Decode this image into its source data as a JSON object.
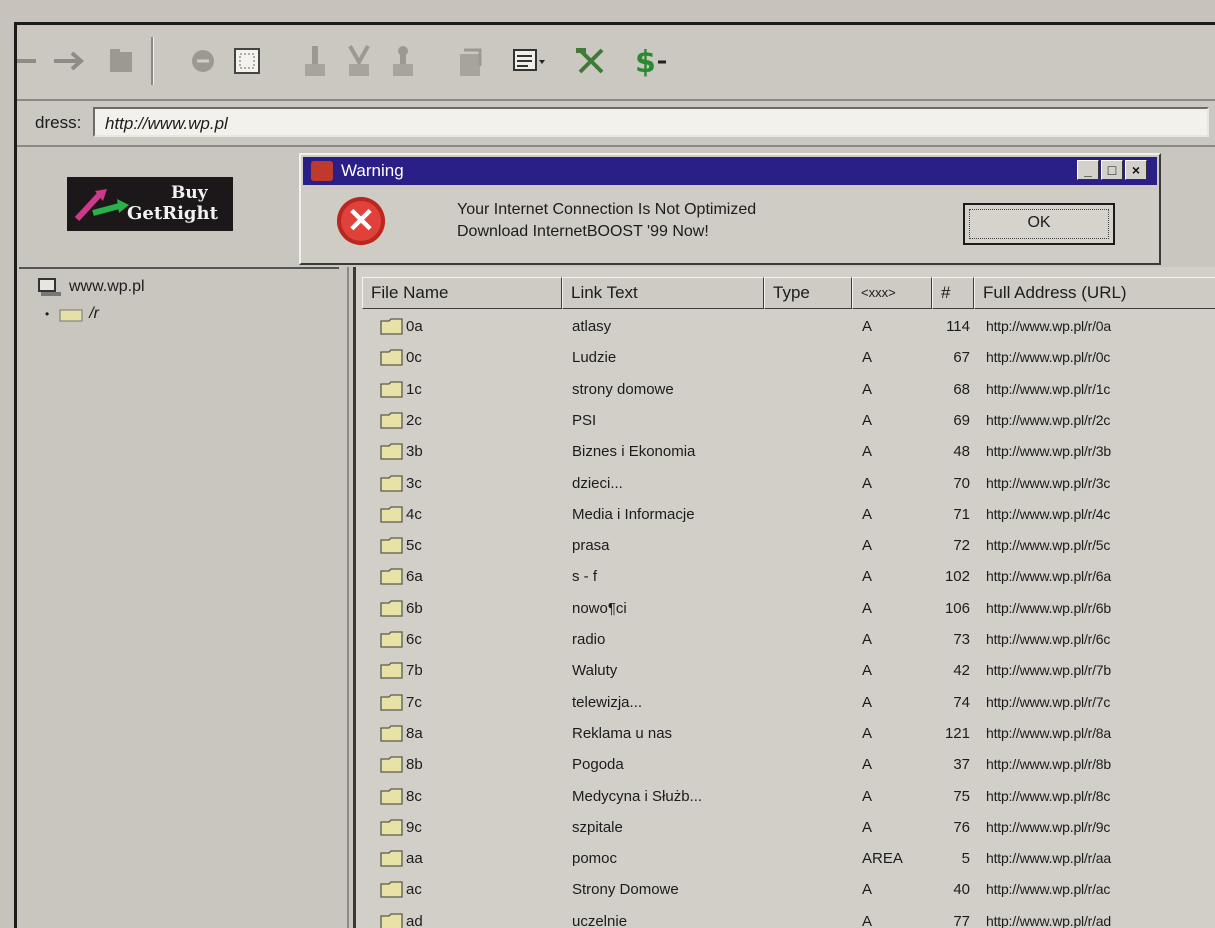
{
  "toolbar": {
    "buttons": [
      "back-icon",
      "forward-icon",
      "folder-icon",
      "stop-icon",
      "select-icon",
      "download-icon",
      "download-all-icon",
      "upload-icon",
      "properties-icon",
      "view-menu-icon",
      "tools-icon",
      "dollar-menu-icon"
    ]
  },
  "address": {
    "label": "dress:",
    "value": "http://www.wp.pl"
  },
  "banner": {
    "buy": "Buy",
    "name": "GetRight"
  },
  "warning": {
    "title": "Warning",
    "line1": "Your Internet Connection Is Not Optimized",
    "line2": "Download InternetBOOST '99 Now!",
    "ok": "OK",
    "min": "_",
    "max": "□",
    "close": "×"
  },
  "tree": {
    "root": "www.wp.pl",
    "child": "/r"
  },
  "columns": {
    "file": "File Name",
    "link": "Link Text",
    "type": "Type",
    "tag": "<xxx>",
    "num": "#",
    "url": "Full Address (URL)"
  },
  "rows": [
    {
      "file": "0a",
      "link": "atlasy",
      "tag": "A",
      "num": "114",
      "url": "http://www.wp.pl/r/0a"
    },
    {
      "file": "0c",
      "link": "Ludzie",
      "tag": "A",
      "num": "67",
      "url": "http://www.wp.pl/r/0c"
    },
    {
      "file": "1c",
      "link": "strony domowe",
      "tag": "A",
      "num": "68",
      "url": "http://www.wp.pl/r/1c"
    },
    {
      "file": "2c",
      "link": "PSI",
      "tag": "A",
      "num": "69",
      "url": "http://www.wp.pl/r/2c"
    },
    {
      "file": "3b",
      "link": "Biznes i Ekonomia",
      "tag": "A",
      "num": "48",
      "url": "http://www.wp.pl/r/3b"
    },
    {
      "file": "3c",
      "link": "dzieci...",
      "tag": "A",
      "num": "70",
      "url": "http://www.wp.pl/r/3c"
    },
    {
      "file": "4c",
      "link": "Media i Informacje",
      "tag": "A",
      "num": "71",
      "url": "http://www.wp.pl/r/4c"
    },
    {
      "file": "5c",
      "link": "prasa",
      "tag": "A",
      "num": "72",
      "url": "http://www.wp.pl/r/5c"
    },
    {
      "file": "6a",
      "link": "s - f",
      "tag": "A",
      "num": "102",
      "url": "http://www.wp.pl/r/6a"
    },
    {
      "file": "6b",
      "link": "nowo¶ci",
      "tag": "A",
      "num": "106",
      "url": "http://www.wp.pl/r/6b"
    },
    {
      "file": "6c",
      "link": "radio",
      "tag": "A",
      "num": "73",
      "url": "http://www.wp.pl/r/6c"
    },
    {
      "file": "7b",
      "link": "Waluty",
      "tag": "A",
      "num": "42",
      "url": "http://www.wp.pl/r/7b"
    },
    {
      "file": "7c",
      "link": "telewizja...",
      "tag": "A",
      "num": "74",
      "url": "http://www.wp.pl/r/7c"
    },
    {
      "file": "8a",
      "link": "Reklama u nas",
      "tag": "A",
      "num": "121",
      "url": "http://www.wp.pl/r/8a"
    },
    {
      "file": "8b",
      "link": "Pogoda",
      "tag": "A",
      "num": "37",
      "url": "http://www.wp.pl/r/8b"
    },
    {
      "file": "8c",
      "link": "Medycyna i Służb...",
      "tag": "A",
      "num": "75",
      "url": "http://www.wp.pl/r/8c"
    },
    {
      "file": "9c",
      "link": "szpitale",
      "tag": "A",
      "num": "76",
      "url": "http://www.wp.pl/r/9c"
    },
    {
      "file": "aa",
      "link": "pomoc",
      "tag": "AREA",
      "num": "5",
      "url": "http://www.wp.pl/r/aa"
    },
    {
      "file": "ac",
      "link": "Strony Domowe",
      "tag": "A",
      "num": "40",
      "url": "http://www.wp.pl/r/ac"
    },
    {
      "file": "ad",
      "link": "uczelnie",
      "tag": "A",
      "num": "77",
      "url": "http://www.wp.pl/r/ad"
    }
  ]
}
